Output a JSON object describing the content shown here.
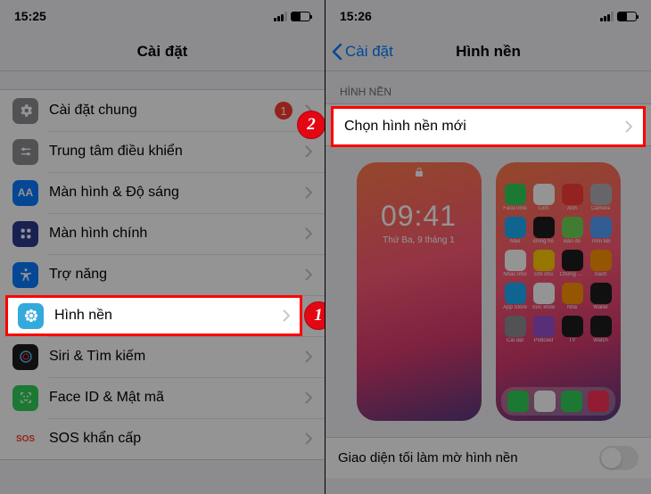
{
  "left": {
    "time": "15:25",
    "title": "Cài đặt",
    "rows": {
      "general": {
        "label": "Cài đặt chung",
        "badge": "1"
      },
      "controlCenter": {
        "label": "Trung tâm điều khiển"
      },
      "display": {
        "label": "Màn hình & Độ sáng"
      },
      "home": {
        "label": "Màn hình chính"
      },
      "accessibility": {
        "label": "Trợ năng"
      },
      "wallpaper": {
        "label": "Hình nền"
      },
      "siri": {
        "label": "Siri & Tìm kiếm"
      },
      "faceid": {
        "label": "Face ID & Mật mã"
      },
      "sos": {
        "label": "SOS khẩn cấp",
        "iconText": "SOS"
      }
    }
  },
  "right": {
    "time": "15:26",
    "back": "Cài đặt",
    "title": "Hình nền",
    "sectionHeader": "HÌNH NỀN",
    "choose": "Chọn hình nền mới",
    "lock": {
      "time": "09:41",
      "date": "Thứ Ba, 9 tháng 1"
    },
    "toggleLabel": "Giao diện tối làm mờ hình nền"
  },
  "markers": {
    "one": "1",
    "two": "2"
  },
  "apps": [
    "FaceTime",
    "Lịch",
    "Ảnh",
    "Camera",
    "Mail",
    "Đồng hồ",
    "Bản đồ",
    "Thời tiết",
    "Nhắc nhở",
    "Ghi chú",
    "Chứng khoán",
    "Sách",
    "App Store",
    "Sức khỏe",
    "Nhà",
    "Wallet",
    "Cài đặt",
    "Podcast",
    "TV",
    "Watch"
  ]
}
